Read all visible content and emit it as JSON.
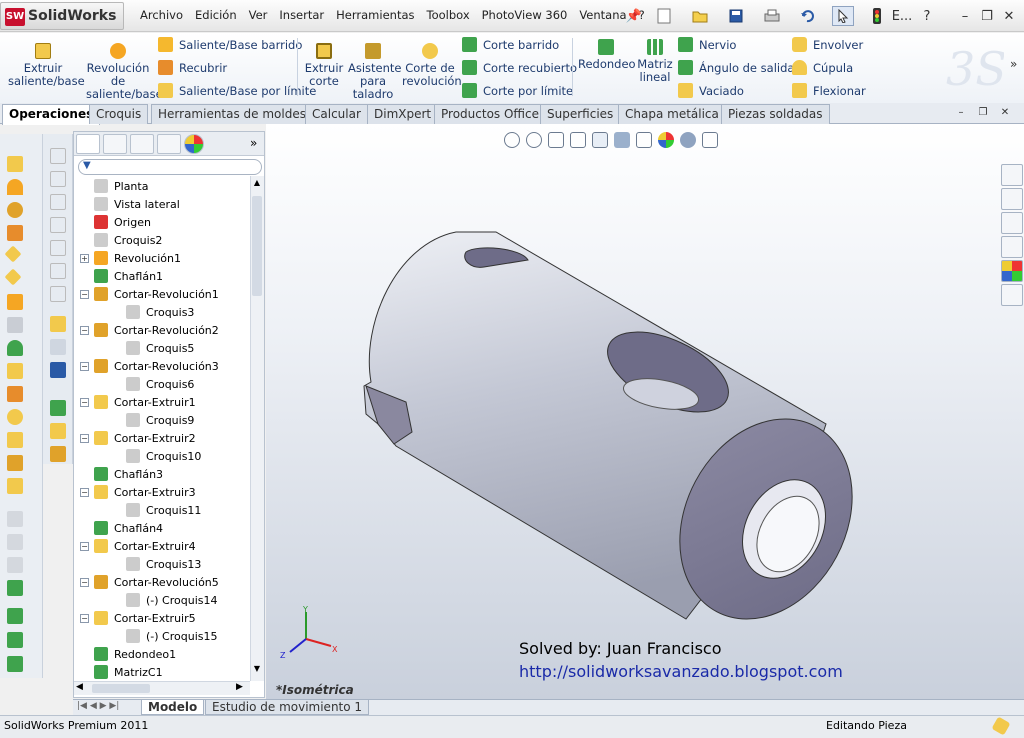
{
  "app": {
    "name": "SolidWorks",
    "badge": "SW"
  },
  "menu": [
    "Archivo",
    "Edición",
    "Ver",
    "Insertar",
    "Herramientas",
    "Toolbox",
    "PhotoView 360",
    "Ventana",
    "?"
  ],
  "titlebar_right": {
    "more": "E...",
    "help": "?"
  },
  "ribbon": {
    "extrude": "Extruir saliente/base",
    "revolve": "Revolución de saliente/base",
    "sweep": "Saliente/Base barrido",
    "loft": "Recubrir",
    "boundary": "Saliente/Base por límite",
    "cut_extrude": "Extruir corte",
    "hole_wizard": "Asistente para taladro",
    "cut_revolve": "Corte de revolución",
    "cut_sweep": "Corte barrido",
    "cut_loft": "Corte recubierto",
    "cut_boundary": "Corte por límite",
    "fillet": "Redondeo",
    "pattern": "Matriz lineal",
    "rib": "Nervio",
    "draft": "Ángulo de salida",
    "shell": "Vaciado",
    "wrap": "Envolver",
    "dome": "Cúpula",
    "flex": "Flexionar"
  },
  "tabs": [
    "Operaciones",
    "Croquis",
    "Herramientas de moldes",
    "Calcular",
    "DimXpert",
    "Productos Office",
    "Superficies",
    "Chapa metálica",
    "Piezas soldadas"
  ],
  "tree": [
    {
      "label": "Planta",
      "expand": ""
    },
    {
      "label": "Vista lateral",
      "expand": ""
    },
    {
      "label": "Origen",
      "expand": ""
    },
    {
      "label": "Croquis2",
      "expand": ""
    },
    {
      "label": "Revolución1",
      "expand": "+"
    },
    {
      "label": "Chaflán1",
      "expand": ""
    },
    {
      "label": "Cortar-Revolución1",
      "expand": "−"
    },
    {
      "label": "Croquis3",
      "expand": ""
    },
    {
      "label": "Cortar-Revolución2",
      "expand": "−"
    },
    {
      "label": "Croquis5",
      "expand": ""
    },
    {
      "label": "Cortar-Revolución3",
      "expand": "−"
    },
    {
      "label": "Croquis6",
      "expand": ""
    },
    {
      "label": "Cortar-Extruir1",
      "expand": "−"
    },
    {
      "label": "Croquis9",
      "expand": ""
    },
    {
      "label": "Cortar-Extruir2",
      "expand": "−"
    },
    {
      "label": "Croquis10",
      "expand": ""
    },
    {
      "label": "Chaflán3",
      "expand": ""
    },
    {
      "label": "Cortar-Extruir3",
      "expand": "−"
    },
    {
      "label": "Croquis11",
      "expand": ""
    },
    {
      "label": "Chaflán4",
      "expand": ""
    },
    {
      "label": "Cortar-Extruir4",
      "expand": "−"
    },
    {
      "label": "Croquis13",
      "expand": ""
    },
    {
      "label": "Cortar-Revolución5",
      "expand": "−"
    },
    {
      "label": "(-) Croquis14",
      "expand": ""
    },
    {
      "label": "Cortar-Extruir5",
      "expand": "−"
    },
    {
      "label": "(-) Croquis15",
      "expand": ""
    },
    {
      "label": "Redondeo1",
      "expand": ""
    },
    {
      "label": "MatrizC1",
      "expand": ""
    }
  ],
  "viewport": {
    "credit": "Solved by: Juan Francisco",
    "url": "http://solidworksavanzado.blogspot.com",
    "view_name": "*Isométrica"
  },
  "bottom_tabs": [
    "Modelo",
    "Estudio de movimiento 1"
  ],
  "status": {
    "left": "SolidWorks Premium 2011",
    "right": "Editando Pieza"
  },
  "colors": {
    "accent": "#1e3b6e",
    "part": "#b9bdcb",
    "link": "#1a2aa8"
  }
}
